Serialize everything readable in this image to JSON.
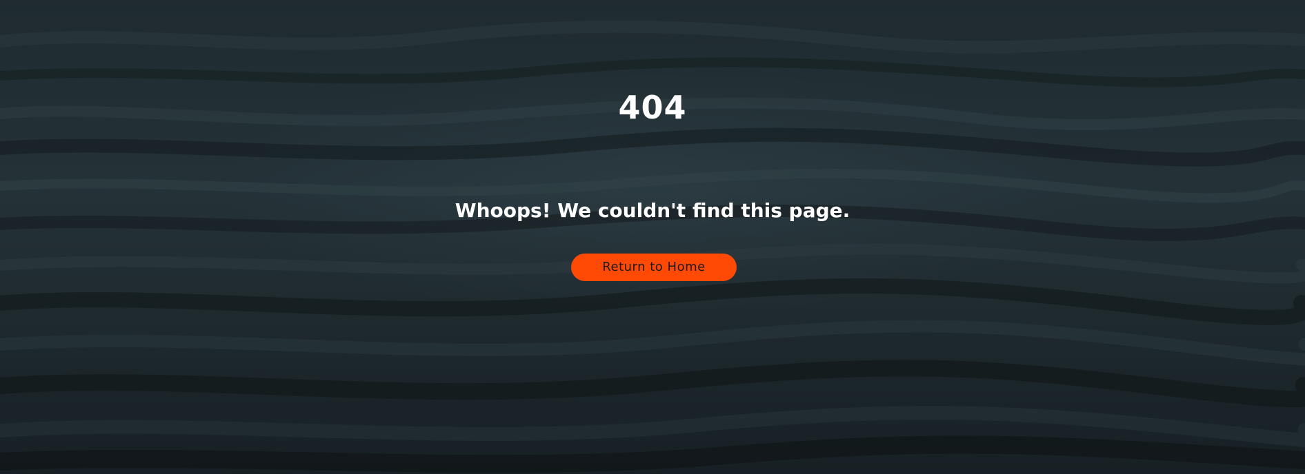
{
  "error": {
    "code": "404",
    "message": "Whoops! We couldn't find this page."
  },
  "actions": {
    "home_label": "Return to Home"
  },
  "theme": {
    "background": "#1b2529",
    "accent": "#ff4a05",
    "text": "#ffffff"
  }
}
